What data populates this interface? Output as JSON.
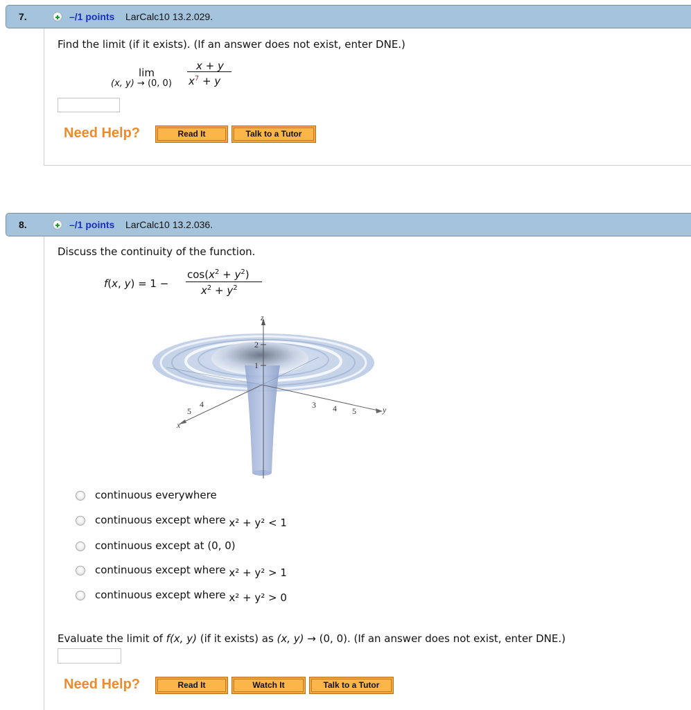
{
  "questions": [
    {
      "number": "7.",
      "points": "–/1 points",
      "reference": "LarCalc10 13.2.029.",
      "prompt": "Find the limit (if it exists). (If an answer does not exist, enter DNE.)",
      "math": {
        "lim": "lim",
        "lim_sub": "(x, y) → (0, 0)",
        "numerator": "x + y",
        "denominator_base": "x",
        "denominator_exp": "7",
        "denominator_rest": " + y",
        "exp_color": "#e02020"
      },
      "answer_value": "",
      "need_help": "Need Help?",
      "help_buttons": [
        "Read It",
        "Talk to a Tutor"
      ]
    },
    {
      "number": "8.",
      "points": "–/1 points",
      "reference": "LarCalc10 13.2.036.",
      "prompt": "Discuss the continuity of the function.",
      "math": {
        "lhs": "f(x, y) = 1 −",
        "numerator": "cos(x² + y²)",
        "denominator": "x² + y²"
      },
      "figure": {
        "axis_labels": {
          "x": "x",
          "y": "y",
          "z": "z"
        },
        "z_ticks": [
          "1",
          "2"
        ],
        "x_ticks": [
          "4",
          "5"
        ],
        "y_ticks": [
          "3",
          "4",
          "5"
        ]
      },
      "options": [
        {
          "text": "continuous everywhere",
          "math": ""
        },
        {
          "text": "continuous except where ",
          "math": "x² + y² < 1"
        },
        {
          "text": "continuous except at (0, 0)",
          "math": ""
        },
        {
          "text": "continuous except where ",
          "math": "x² + y² > 1"
        },
        {
          "text": "continuous except where ",
          "math": "x² + y² > 0"
        }
      ],
      "selected_option": null,
      "part2_prompt_pre": "Evaluate the limit of ",
      "part2_fn": "f(x, y)",
      "part2_mid": " (if it exists) as ",
      "part2_xy": "(x, y)",
      "part2_post": " → (0, 0).  (If an answer does not exist, enter DNE.)",
      "answer_value": "",
      "need_help": "Need Help?",
      "help_buttons": [
        "Read It",
        "Watch It",
        "Talk to a Tutor"
      ]
    }
  ],
  "colors": {
    "header_bg": "#a4c4de",
    "points_link": "#1a2fc0",
    "need_help": "#ef8a2b",
    "button_bg": "#fbb548"
  }
}
